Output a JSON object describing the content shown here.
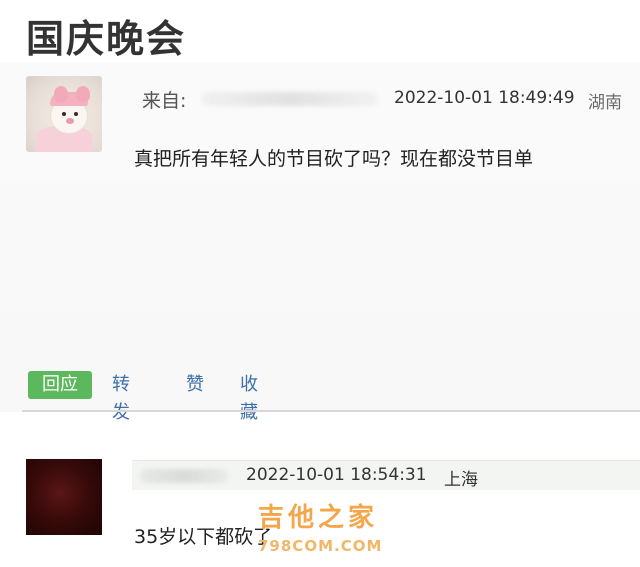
{
  "page": {
    "title": "国庆晚会"
  },
  "post": {
    "from_label": "来自:",
    "timestamp": "2022-10-01 18:49:49",
    "location": "湖南",
    "content": "真把所有年轻人的节目砍了吗？现在都没节目单"
  },
  "actions": {
    "reply": "回应",
    "forward": "转发",
    "like": "赞",
    "favorite": "收藏"
  },
  "reply": {
    "timestamp": "2022-10-01 18:54:31",
    "location": "上海",
    "content": "35岁以下都砍了"
  },
  "watermark": {
    "text": "吉他之家",
    "url": "798COM.COM"
  },
  "colors": {
    "reply_button_bg": "#5cb85c",
    "link_blue": "#3d6fa8",
    "watermark_orange": "#f3a64a"
  }
}
